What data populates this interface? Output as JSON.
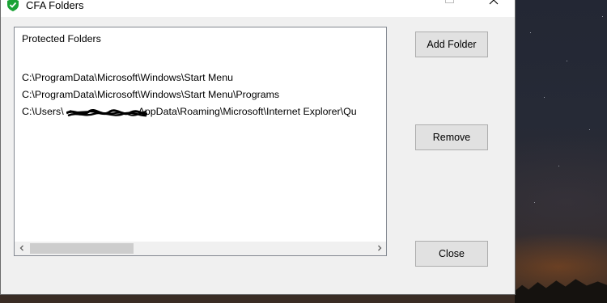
{
  "window": {
    "title": "CFA Folders"
  },
  "list": {
    "header": "Protected Folders",
    "items": [
      "C:\\ProgramData\\Microsoft\\Windows\\Start Menu",
      "C:\\ProgramData\\Microsoft\\Windows\\Start Menu\\Programs",
      "C:\\Users\\",
      "AppData\\Roaming\\Microsoft\\Internet Explorer\\Qu"
    ]
  },
  "buttons": {
    "add": "Add Folder",
    "remove": "Remove",
    "close": "Close"
  },
  "icons": {
    "app": "shield-check-icon",
    "minimize": "minimize-icon",
    "maximize": "maximize-icon",
    "close": "close-icon",
    "scroll_left": "chevron-left-icon",
    "scroll_right": "chevron-right-icon"
  },
  "colors": {
    "shield": "#1aa235",
    "window_bg": "#f0f0f0",
    "button_bg": "#e1e1e1"
  }
}
